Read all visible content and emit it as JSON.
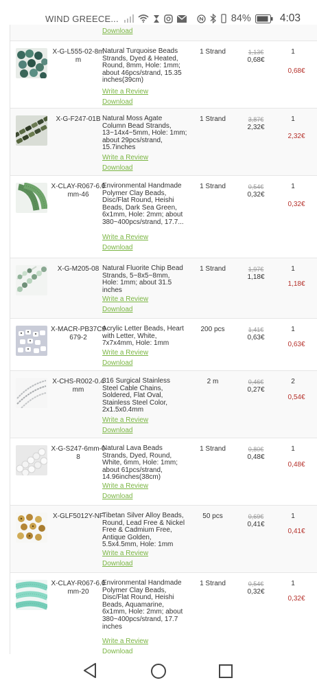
{
  "status_bar": {
    "carrier": "WIND GREECE...",
    "battery": "84%",
    "time": "4:03"
  },
  "top_partial": {
    "download_label": "Download"
  },
  "rows": [
    {
      "code": "X-G-L555-02-8mm",
      "desc": "Natural Turquoise Beads Strands, Dyed & Heated, Round, 8mm, Hole: 1mm; about 46pcs/strand, 15.35 inches(39cm)",
      "unit": "1 Strand",
      "old_price": "1,13€",
      "price": "0,68€",
      "qty": "1",
      "total": "0,68€",
      "review": "Write a Review",
      "download": "Download"
    },
    {
      "code": "X-G-F247-01B",
      "desc": "Natural Moss Agate Column Bead Strands, 13~14x4~5mm, Hole: 1mm; about 29pcs/strand, 15.7inches",
      "unit": "1 Strand",
      "old_price": "3,87€",
      "price": "2,32€",
      "qty": "1",
      "total": "2,32€",
      "review": "Write a Review",
      "download": "Download"
    },
    {
      "code": "X-CLAY-R067-6.0mm-46",
      "desc": "Environmental Handmade Polymer Clay Beads, Disc/Flat Round, Heishi Beads, Dark Sea Green, 6x1mm, Hole: 2mm; about 380~400pcs/strand, 17.7...",
      "unit": "1 Strand",
      "old_price": "0,54€",
      "price": "0,32€",
      "qty": "1",
      "total": "0,32€",
      "review": "Write a Review",
      "download": "Download"
    },
    {
      "code": "X-G-M205-08",
      "desc": "Natural Fluorite Chip Bead Strands, 5~8x5~8mm, Hole: 1mm; about 31.5 inches",
      "unit": "1 Strand",
      "old_price": "1,97€",
      "price": "1,18€",
      "qty": "1",
      "total": "1,18€",
      "review": "Write a Review",
      "download": "Download"
    },
    {
      "code": "X-MACR-PB37C9679-2",
      "desc": "Acrylic Letter Beads, Heart with Letter, White, 7x7x4mm, Hole: 1mm",
      "unit": "200 pcs",
      "old_price": "1,41€",
      "price": "0,63€",
      "qty": "1",
      "total": "0,63€",
      "review": "Write a Review",
      "download": "Download"
    },
    {
      "code": "X-CHS-R002-0.4mm",
      "desc": "316 Surgical Stainless Steel Cable Chains, Soldered, Flat Oval, Stainless Steel Color, 2x1.5x0.4mm",
      "unit": "2 m",
      "old_price": "0,46€",
      "price": "0,27€",
      "qty": "2",
      "total": "0,54€",
      "review": "Write a Review",
      "download": "Download"
    },
    {
      "code": "X-G-S247-6mm-08",
      "desc": "Natural Lava Beads Strands, Dyed, Round, White, 6mm, Hole: 1mm; about 61pcs/strand, 14.96inches(38cm)",
      "unit": "1 Strand",
      "old_price": "0,80€",
      "price": "0,48€",
      "qty": "1",
      "total": "0,48€",
      "review": "Write a Review",
      "download": "Download"
    },
    {
      "code": "X-GLF5012Y-NF",
      "desc": "Tibetan Silver Alloy Beads, Round, Lead Free & Nickel Free & Cadmium Free, Antique Golden, 5.5x4.5mm, Hole: 1mm",
      "unit": "50 pcs",
      "old_price": "0,69€",
      "price": "0,41€",
      "qty": "1",
      "total": "0,41€",
      "review": "Write a Review",
      "download": "Download"
    },
    {
      "code": "X-CLAY-R067-6.0mm-20",
      "desc": "Environmental Handmade Polymer Clay Beads, Disc/Flat Round, Heishi Beads, Aquamarine, 6x1mm, Hole: 2mm; about 380~400pcs/strand, 17.7 inches",
      "unit": "1 Strand",
      "old_price": "0,54€",
      "price": "0,32€",
      "qty": "1",
      "total": "0,32€",
      "review": "Write a Review",
      "download": "Download"
    }
  ]
}
